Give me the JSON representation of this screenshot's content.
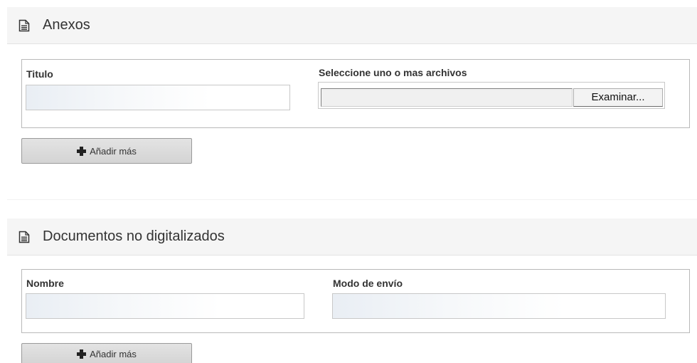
{
  "anexos": {
    "title": "Anexos",
    "icon": "document-icon",
    "titulo_label": "Titulo",
    "titulo_value": "",
    "archivos_label": "Seleccione uno o mas archivos",
    "examinar_label": "Examinar...",
    "add_label": "Añadir más"
  },
  "no_digitalizados": {
    "title": "Documentos no digitalizados",
    "icon": "document-icon",
    "nombre_label": "Nombre",
    "nombre_value": "",
    "modo_label": "Modo de envío",
    "modo_value": "",
    "add_label": "Añadir más"
  }
}
